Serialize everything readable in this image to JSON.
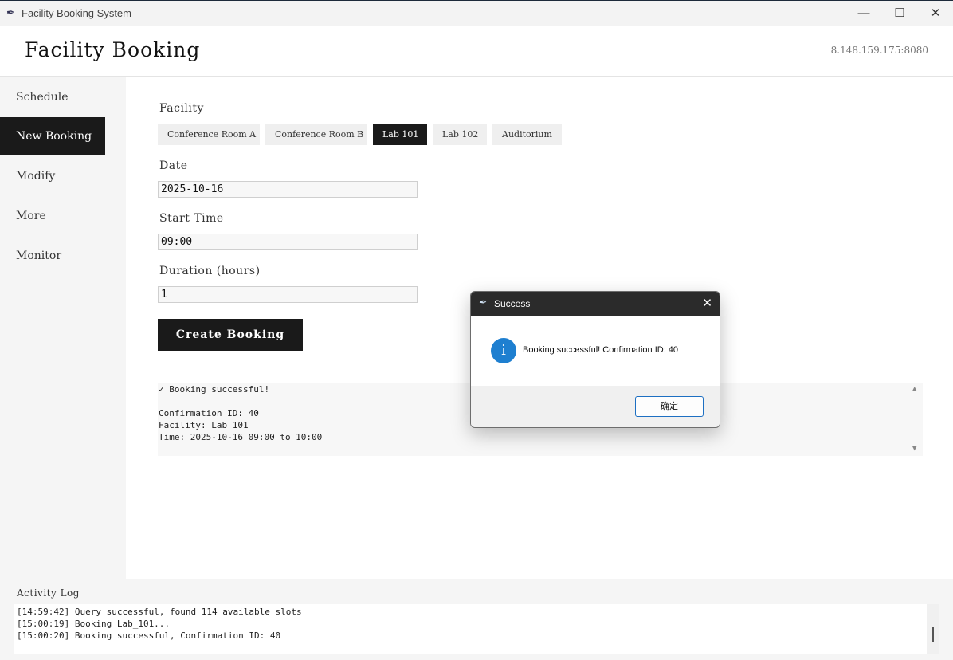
{
  "window": {
    "title": "Facility Booking System",
    "app_icon": "feather-icon",
    "controls": {
      "minimize": "—",
      "maximize": "☐",
      "close": "✕"
    }
  },
  "header": {
    "title": "Facility Booking",
    "server": "8.148.159.175:8080"
  },
  "sidebar": {
    "items": [
      {
        "label": "Schedule",
        "active": false
      },
      {
        "label": "New Booking",
        "active": true
      },
      {
        "label": "Modify",
        "active": false
      },
      {
        "label": "More",
        "active": false
      },
      {
        "label": "Monitor",
        "active": false
      }
    ]
  },
  "form": {
    "facility_label": "Facility",
    "facilities": [
      {
        "label": "Conference Room A",
        "selected": false
      },
      {
        "label": "Conference Room B",
        "selected": false
      },
      {
        "label": "Lab 101",
        "selected": true
      },
      {
        "label": "Lab 102",
        "selected": false
      },
      {
        "label": "Auditorium",
        "selected": false
      }
    ],
    "date_label": "Date",
    "date_value": "2025-10-16",
    "start_label": "Start Time",
    "start_value": "09:00",
    "duration_label": "Duration (hours)",
    "duration_value": "1",
    "create_button": "Create Booking"
  },
  "result": {
    "lines": [
      "✓ Booking successful!",
      "",
      "Confirmation ID: 40",
      "Facility: Lab_101",
      "Time: 2025-10-16 09:00 to 10:00"
    ],
    "scroll_up": "▲",
    "scroll_down": "▼"
  },
  "activity_log": {
    "title": "Activity Log",
    "lines": [
      "[14:59:42] Query successful, found 114 available slots",
      "[15:00:19] Booking Lab_101...",
      "[15:00:20] Booking successful, Confirmation ID: 40"
    ]
  },
  "dialog": {
    "title": "Success",
    "close_glyph": "✕",
    "icon": "info-icon",
    "icon_glyph": "i",
    "message": "Booking successful! Confirmation ID: 40",
    "ok_button": "确定",
    "accent_color": "#1e7fd0"
  }
}
